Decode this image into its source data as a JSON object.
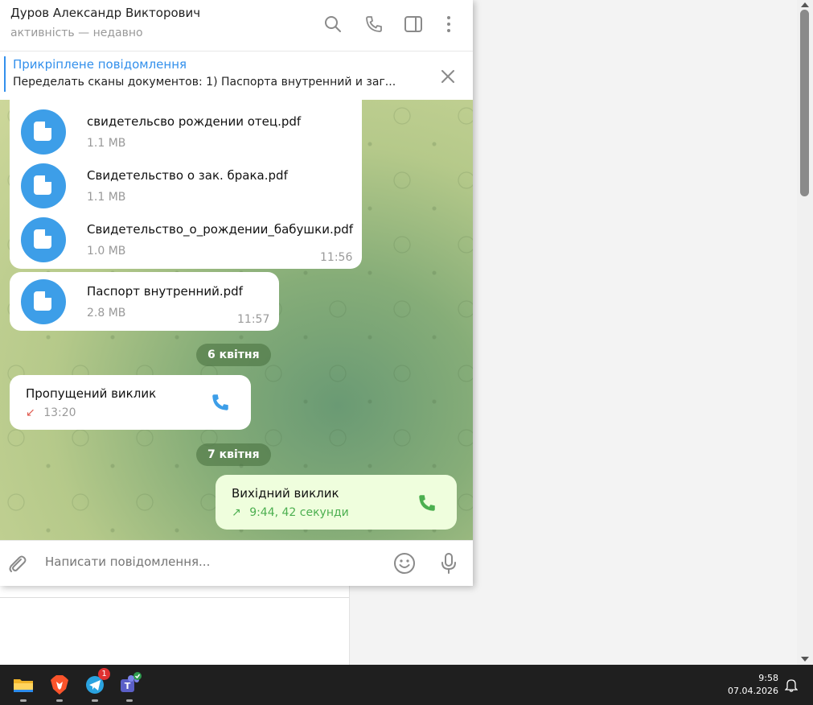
{
  "window": {
    "contact_name": "Дуров Александр Викторович",
    "contact_status": "активність — недавно",
    "header_icons": [
      "search-icon",
      "phone-icon",
      "sidebar-toggle-icon",
      "more-vertical-icon"
    ]
  },
  "pinned": {
    "title": "Прикріплене повідомлення",
    "text": "Переделать сканы документов:  1) Паспорта внутренний и заг..."
  },
  "messages": {
    "files_group": [
      {
        "name": "свидетельсво рождении отец.pdf",
        "size": "1.1 MB"
      },
      {
        "name": "Свидетельство о зак. брака.pdf",
        "size": "1.1 MB"
      },
      {
        "name": "Свидетельство_о_рождении_бабушки.pdf",
        "size": "1.0 MB"
      }
    ],
    "files_group_time": "11:56",
    "single_file": {
      "name": "Паспорт внутренний.pdf",
      "size": "2.8 MB",
      "time": "11:57"
    },
    "date_1": "6 квітня",
    "missed_call": {
      "title": "Пропущений виклик",
      "meta": "13:20",
      "arrow": "↙"
    },
    "date_2": "7 квітня",
    "outgoing_call": {
      "title": "Вихідний виклик",
      "meta": "9:44, 42 секунди",
      "arrow": "↗"
    }
  },
  "composer": {
    "placeholder": "Написати повідомлення..."
  },
  "taskbar": {
    "apps": [
      "file-explorer-icon",
      "brave-browser-icon",
      "telegram-icon",
      "teams-icon"
    ],
    "telegram_badge": "1",
    "time": "9:58",
    "date": "07.04.2026"
  },
  "colors": {
    "accent": "#3390ec",
    "missed": "#e05a4f",
    "outgoing": "#4caf50",
    "file_icon": "#3d9ee8"
  }
}
